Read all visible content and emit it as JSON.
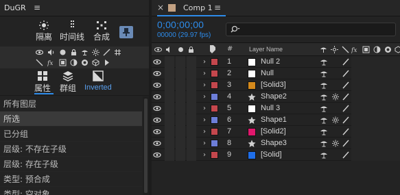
{
  "left_panel": {
    "title": "DuGR",
    "menu_glyph": "≡",
    "tools": [
      {
        "label": "隔离",
        "icon": "isolate-icon"
      },
      {
        "label": "时间线",
        "icon": "timeline-icon"
      },
      {
        "label": "合成",
        "icon": "compose-icon"
      }
    ],
    "pin_icon": "pin-icon",
    "icon_rows": [
      [
        "eye-icon",
        "speaker-icon",
        "solo-icon",
        "lock-icon",
        "shy-icon",
        "collapse-icon",
        "quality-icon",
        "hash-icon"
      ],
      [
        "effect-icon",
        "fx-icon",
        "frame-blend-icon",
        "motion-blur-icon",
        "adjustment-icon",
        "3d-icon",
        "play-icon"
      ]
    ],
    "modes": [
      {
        "label": "属性",
        "icon": "grid-icon"
      },
      {
        "label": "群组",
        "icon": "layers-stack-icon"
      },
      {
        "label": "Inverted",
        "icon": "invert-icon"
      }
    ],
    "filters": [
      {
        "label": "所有图层",
        "selected": false
      },
      {
        "label": "所选",
        "selected": true
      },
      {
        "label": "已分组",
        "selected": false
      },
      {
        "label": "层级: 不存在子级",
        "selected": false
      },
      {
        "label": "层级: 存在子级",
        "selected": false
      },
      {
        "label": "类型: 预合成",
        "selected": false
      },
      {
        "label": "类型: 空对象",
        "selected": false
      }
    ]
  },
  "comp_panel": {
    "tab_close": "×",
    "tab_label": "Comp 1",
    "tab_menu": "≡",
    "timecode": "0;00;00;00",
    "fps": "00000 (29.97 fps)",
    "search_placeholder": "",
    "columns": {
      "hash": "#",
      "layer_name": "Layer Name"
    },
    "layers": [
      {
        "num": "1",
        "name": "Null 2",
        "type": "white",
        "color": "#c4474d",
        "swatch": "#ffffff",
        "shy": true,
        "collapse": false
      },
      {
        "num": "2",
        "name": "Null",
        "type": "white",
        "color": "#c4474d",
        "swatch": "#ffffff",
        "shy": true,
        "collapse": false
      },
      {
        "num": "3",
        "name": "[Solid3]",
        "type": "solid",
        "color": "#c4474d",
        "swatch": "#d58a1c",
        "shy": true,
        "collapse": false
      },
      {
        "num": "4",
        "name": "Shape2",
        "type": "star",
        "color": "#6d7ed8",
        "swatch": "",
        "shy": true,
        "collapse": true
      },
      {
        "num": "5",
        "name": "Null 3",
        "type": "white",
        "color": "#c4474d",
        "swatch": "#ffffff",
        "shy": true,
        "collapse": false
      },
      {
        "num": "6",
        "name": "Shape1",
        "type": "star",
        "color": "#6d7ed8",
        "swatch": "",
        "shy": true,
        "collapse": true
      },
      {
        "num": "7",
        "name": "[Solid2]",
        "type": "solid",
        "color": "#c4474d",
        "swatch": "#e0176c",
        "shy": true,
        "collapse": false
      },
      {
        "num": "8",
        "name": "Shape3",
        "type": "star",
        "color": "#6d7ed8",
        "swatch": "",
        "shy": true,
        "collapse": true
      },
      {
        "num": "9",
        "name": "[Solid]",
        "type": "solid",
        "color": "#c4474d",
        "swatch": "#1f6ee8",
        "shy": true,
        "collapse": false
      }
    ]
  },
  "colors": {
    "accent": "#2d8ceb",
    "panel_bg": "#232323",
    "label_red": "#c4474d",
    "label_blue": "#6d7ed8"
  }
}
